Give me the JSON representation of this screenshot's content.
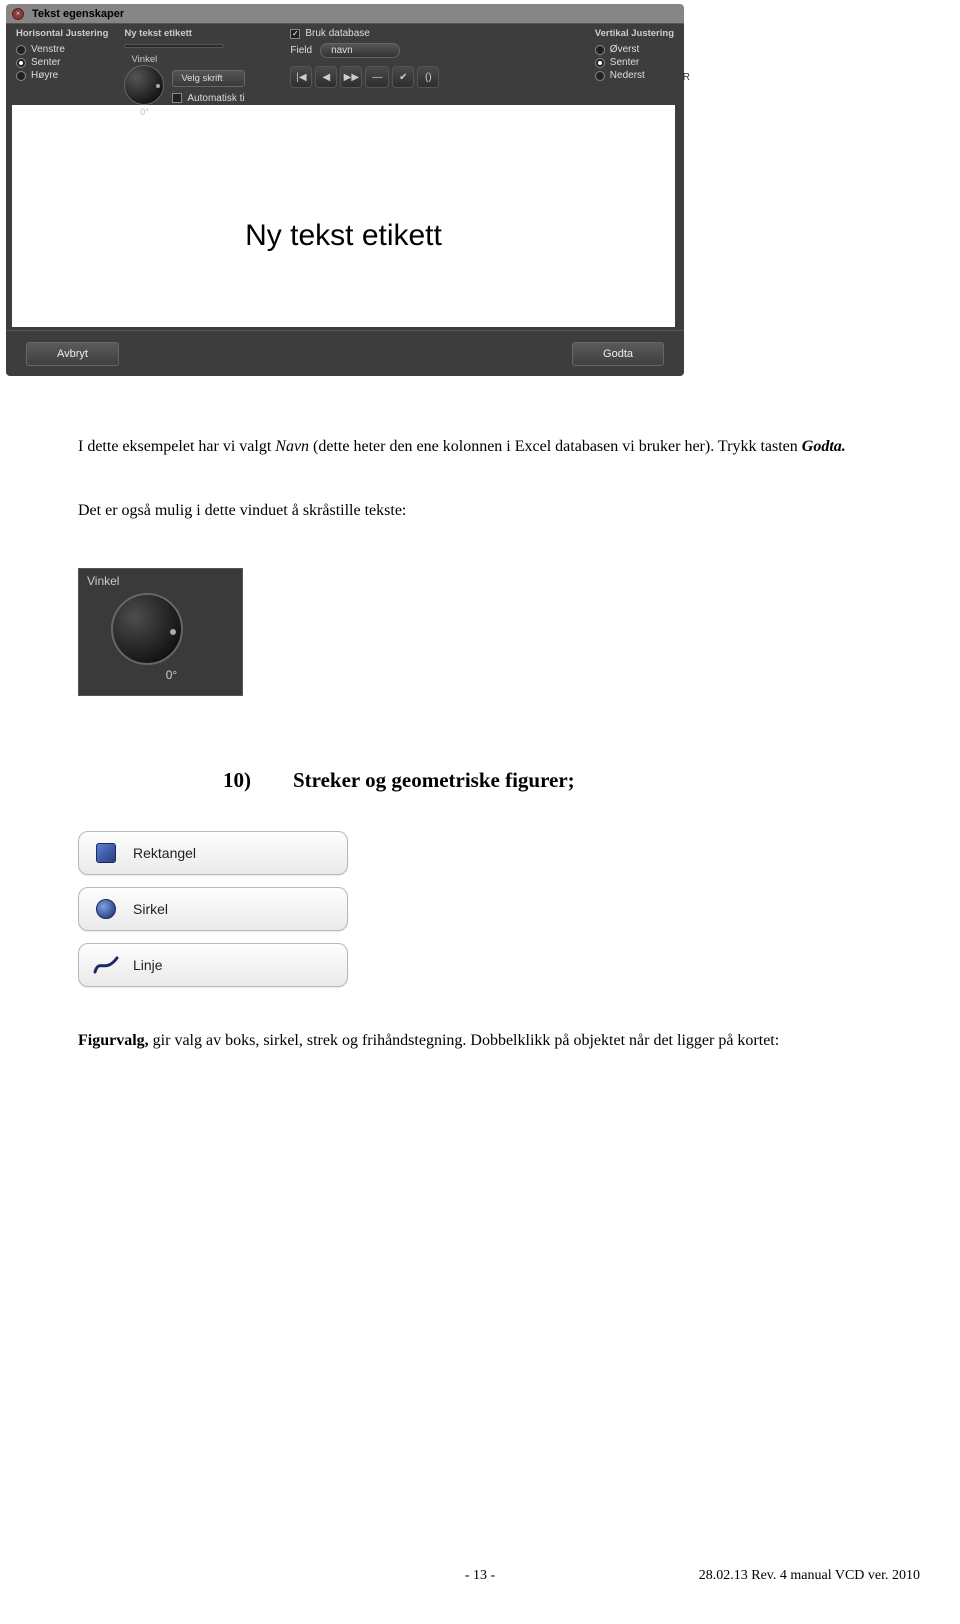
{
  "dialog1": {
    "title": "Tekst egenskaper",
    "horizJustHeader": "Horisontal Justering",
    "horizOptions": [
      "Venstre",
      "Senter",
      "Høyre"
    ],
    "newLabelHeader": "Ny tekst etikett",
    "vinkelHeader": "Vinkel",
    "vinkelValue": "0°",
    "velgSkrift": "Velg skrift",
    "autoText": "Automatisk ti",
    "useDb": "Bruk database",
    "fieldLabel": "Field",
    "fieldValue": "navn",
    "vertJustHeader": "Vertikal Justering",
    "vertOptions": [
      "Øverst",
      "Senter",
      "Nederst"
    ],
    "canvasText": "Ny tekst etikett",
    "cancel": "Avbryt",
    "accept": "Godta"
  },
  "sideRight": "R",
  "para1_a": "I dette eksempelet har vi valgt ",
  "para1_b": "Navn",
  "para1_c": " (dette heter den ene kolonnen i Excel databasen vi bruker her). Trykk tasten ",
  "para1_d": "Godta.",
  "para2": "Det er også mulig i dette vinduet å skråstille tekste:",
  "dialog2": {
    "label": "Vinkel",
    "value": "0°"
  },
  "heading": {
    "num": "10)",
    "text": "Streker og geometriske figurer;"
  },
  "buttons": {
    "rect": "Rektangel",
    "circ": "Sirkel",
    "line": "Linje"
  },
  "para3_a": "Figurvalg,",
  "para3_b": " gir valg av boks, sirkel, strek og frihåndstegning. Dobbelklikk på objektet når det ligger på kortet:",
  "footer": {
    "pageNum": "- 13 -",
    "rev": "28.02.13  Rev. 4 manual VCD ver. 2010"
  }
}
